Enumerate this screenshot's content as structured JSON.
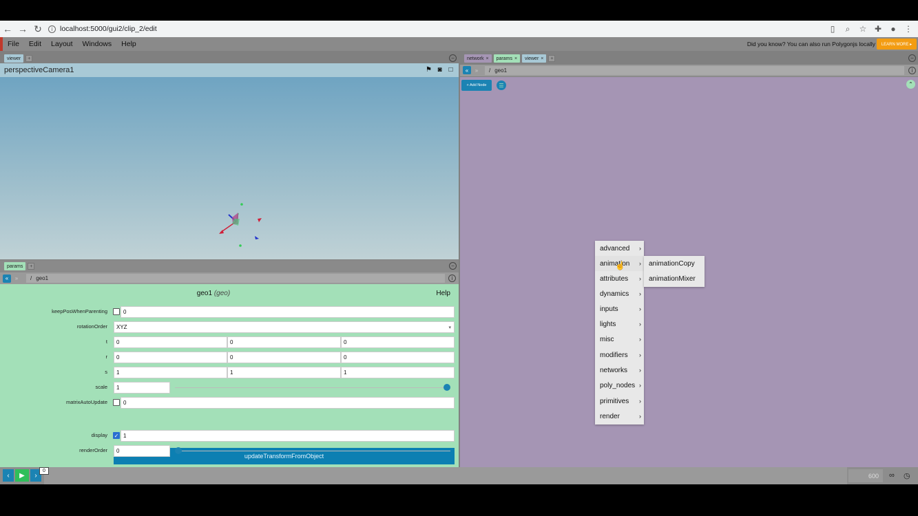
{
  "browser": {
    "url": "localhost:5000/gui2/clip_2/edit",
    "icons": [
      "back-arrow-icon",
      "forward-arrow-icon",
      "reload-icon",
      "info-icon",
      "bookmark-icon",
      "zoom-icon",
      "star-icon",
      "extension-icon",
      "profile-icon",
      "more-icon"
    ]
  },
  "menubar": {
    "items": [
      "File",
      "Edit",
      "Layout",
      "Windows",
      "Help"
    ],
    "promo": "Did you know? You can also run Polygonjs locally",
    "learn_more": "LEARN MORE ▸"
  },
  "viewer": {
    "tab": "viewer",
    "camera": "perspectiveCamera1"
  },
  "params": {
    "tab": "params",
    "path": "geo1",
    "node_name": "geo1",
    "node_type": "(geo)",
    "help": "Help",
    "rows": {
      "keepPosWhenParenting": {
        "label": "keepPosWhenParenting",
        "value": "0"
      },
      "rotationOrder": {
        "label": "rotationOrder",
        "value": "XYZ"
      },
      "t": {
        "label": "t",
        "x": "0",
        "y": "0",
        "z": "0"
      },
      "r": {
        "label": "r",
        "x": "0",
        "y": "0",
        "z": "0"
      },
      "s": {
        "label": "s",
        "x": "1",
        "y": "1",
        "z": "1"
      },
      "scale": {
        "label": "scale",
        "value": "1"
      },
      "matrixAutoUpdate": {
        "label": "matrixAutoUpdate",
        "value": "0"
      },
      "updateButton": "updateTransformFromObject",
      "display": {
        "label": "display",
        "value": "1"
      },
      "renderOrder": {
        "label": "renderOrder",
        "value": "0"
      }
    }
  },
  "network": {
    "tabs": [
      "network",
      "params",
      "viewer"
    ],
    "path": "geo1",
    "add_node": "+ Add Node"
  },
  "context_menu": {
    "items": [
      "advanced",
      "animation",
      "attributes",
      "dynamics",
      "inputs",
      "lights",
      "misc",
      "modifiers",
      "networks",
      "poly_nodes",
      "primitives",
      "render"
    ],
    "submenu": [
      "animationCopy",
      "animationMixer"
    ]
  },
  "timeline": {
    "current_frame": "0",
    "end_frame": "600"
  },
  "colors": {
    "accent": "#1b83b3",
    "params_bg": "#a3e0b8",
    "network_bg": "#a595b4"
  }
}
